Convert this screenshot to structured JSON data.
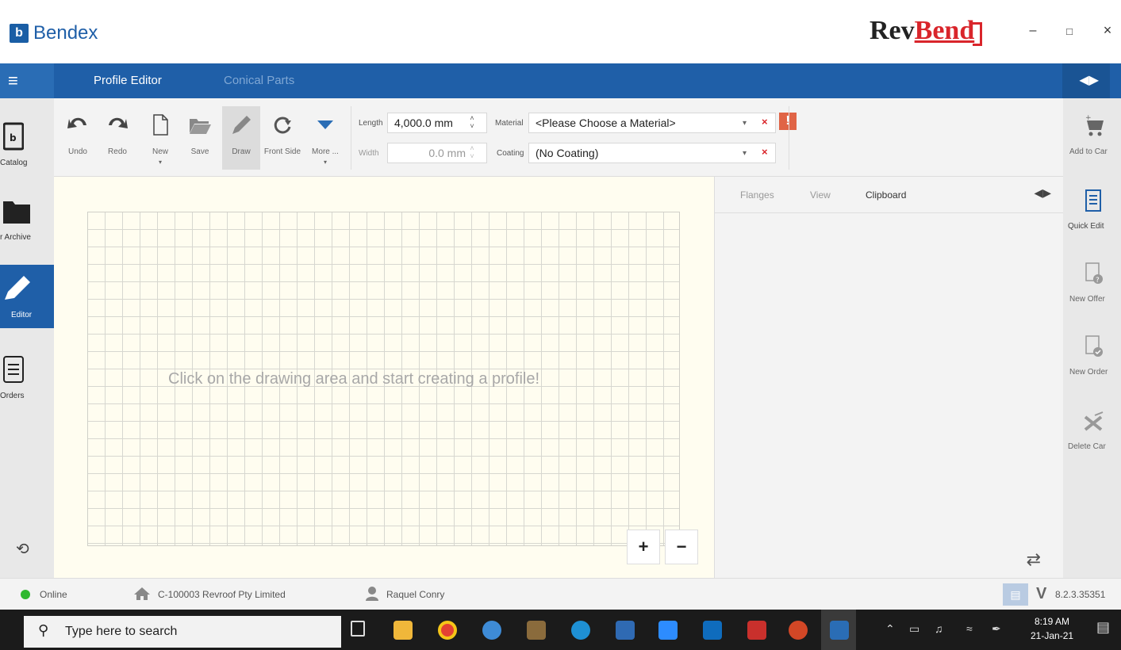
{
  "window": {
    "app_logo_letter": "b",
    "app_name": "Bendex",
    "brand_part1": "Rev",
    "brand_part2": "Bend",
    "minimize": "–",
    "maximize": "□",
    "close": "×"
  },
  "nav": {
    "menu_glyph": "≡",
    "tabs": [
      {
        "label": "Profile Editor",
        "active": true
      },
      {
        "label": "Conical Parts",
        "active": false
      }
    ],
    "collapse_glyph": "◀▶"
  },
  "left_sidebar": {
    "items": [
      {
        "label": "Catalog",
        "icon": "catalog-icon",
        "active": false
      },
      {
        "label": "r Archive",
        "icon": "folder-icon",
        "active": false
      },
      {
        "label": "Editor",
        "icon": "pencil-icon",
        "active": true
      },
      {
        "label": "Orders",
        "icon": "orders-icon",
        "active": false
      }
    ],
    "sync_glyph": "⟲"
  },
  "toolbar": {
    "buttons": [
      {
        "label": "Undo",
        "icon": "undo-icon"
      },
      {
        "label": "Redo",
        "icon": "redo-icon"
      },
      {
        "label": "New",
        "icon": "new-document-icon",
        "caret": "▾"
      },
      {
        "label": "Save",
        "icon": "folder-open-icon"
      },
      {
        "label": "Draw",
        "icon": "pencil-icon",
        "pressed": true
      },
      {
        "label": "Front Side",
        "icon": "rotate-icon"
      },
      {
        "label": "More ...",
        "icon": "triangle-down-icon",
        "caret": "▾"
      }
    ],
    "length_label": "Length",
    "length_value": "4,000.0 mm",
    "width_label": "Width",
    "width_value": "0.0 mm",
    "material_label": "Material",
    "material_value": "<Please Choose a Material>",
    "coating_label": "Coating",
    "coating_value": "(No Coating)",
    "warning_glyph": "!",
    "clear_glyph": "×",
    "dropdown_glyph": "▾",
    "spin_up": "˄",
    "spin_down": "˅"
  },
  "canvas": {
    "hint": "Click on the drawing area and start creating a profile!",
    "zoom_in": "+",
    "zoom_out": "−"
  },
  "right_panel": {
    "tabs": [
      {
        "label": "Flanges",
        "active": false
      },
      {
        "label": "View",
        "active": false
      },
      {
        "label": "Clipboard",
        "active": true
      }
    ],
    "collapse_glyph": "◀▶",
    "swap_glyph": "⇄"
  },
  "right_sidebar": {
    "items": [
      {
        "label": "Add to Car",
        "icon": "cart-icon"
      },
      {
        "label": "Quick Edit",
        "icon": "quick-edit-icon"
      },
      {
        "label": "New Offer",
        "icon": "new-offer-icon"
      },
      {
        "label": "New Order",
        "icon": "new-order-icon"
      },
      {
        "label": "Delete Car",
        "icon": "delete-cart-icon"
      }
    ]
  },
  "status": {
    "online": "Online",
    "company": "C-100003 Revroof Pty Limited",
    "user": "Raquel Conry",
    "version_letter": "V",
    "version": "8.2.3.35351"
  },
  "taskbar": {
    "search_placeholder": "Type here to search",
    "time": "8:19 AM",
    "date": "21-Jan-21"
  },
  "colors": {
    "brand_blue": "#1f5fa8",
    "brand_red": "#d9252b",
    "canvas_bg": "#fffdf0",
    "online_green": "#2eb82e"
  }
}
